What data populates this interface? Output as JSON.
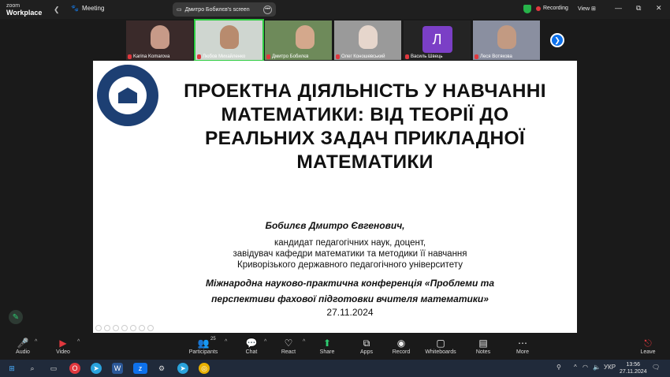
{
  "titlebar": {
    "brand_line1": "zoom",
    "brand_line2": "Workplace",
    "meeting_label": "Meeting",
    "screen_label": "Дмитро Бобилєв's screen",
    "recording_label": "Recording",
    "view_label": "View"
  },
  "participants": [
    {
      "name": "Karina Komarova",
      "muted": true
    },
    {
      "name": "Любов Михайленко",
      "muted": true,
      "active": true
    },
    {
      "name": "Дмитро Бобилєв",
      "muted": true
    },
    {
      "name": "Олег Коношевський",
      "muted": true
    },
    {
      "name": "Василь Швець",
      "muted": true,
      "initial": "Л"
    },
    {
      "name": "Леся Вотякова",
      "muted": true
    }
  ],
  "slide": {
    "title": "ПРОЕКТНА ДІЯЛЬНІСТЬ У НАВЧАННІ МАТЕМАТИКИ: ВІД ТЕОРІЇ ДО РЕАЛЬНИХ ЗАДАЧ ПРИКЛАДНОЇ МАТЕМАТИКИ",
    "author": "Бобилєв Дмитро Євгенович,",
    "position_line1": "кандидат педагогічних наук, доцент,",
    "position_line2": "завідувач кафедри математики та методики її навчання",
    "position_line3": "Криворізького державного педагогічного університету",
    "conference_line1": "Міжнародна науково-практична конференція «Проблеми та",
    "conference_line2": "перспективи фахової підготовки вчителя математики»",
    "date": "27.11.2024"
  },
  "toolbar": {
    "audio": "Audio",
    "video": "Video",
    "participants": "Participants",
    "participants_count": "25",
    "chat": "Chat",
    "react": "React",
    "share": "Share",
    "apps": "Apps",
    "record": "Record",
    "whiteboards": "Whiteboards",
    "notes": "Notes",
    "more": "More",
    "leave": "Leave"
  },
  "taskbar": {
    "language": "УКР",
    "time": "13:56",
    "date": "27.11.2024"
  },
  "colors": {
    "share_green": "#2ecc71",
    "record_red": "#e0383e",
    "accent_blue": "#0e71eb"
  }
}
